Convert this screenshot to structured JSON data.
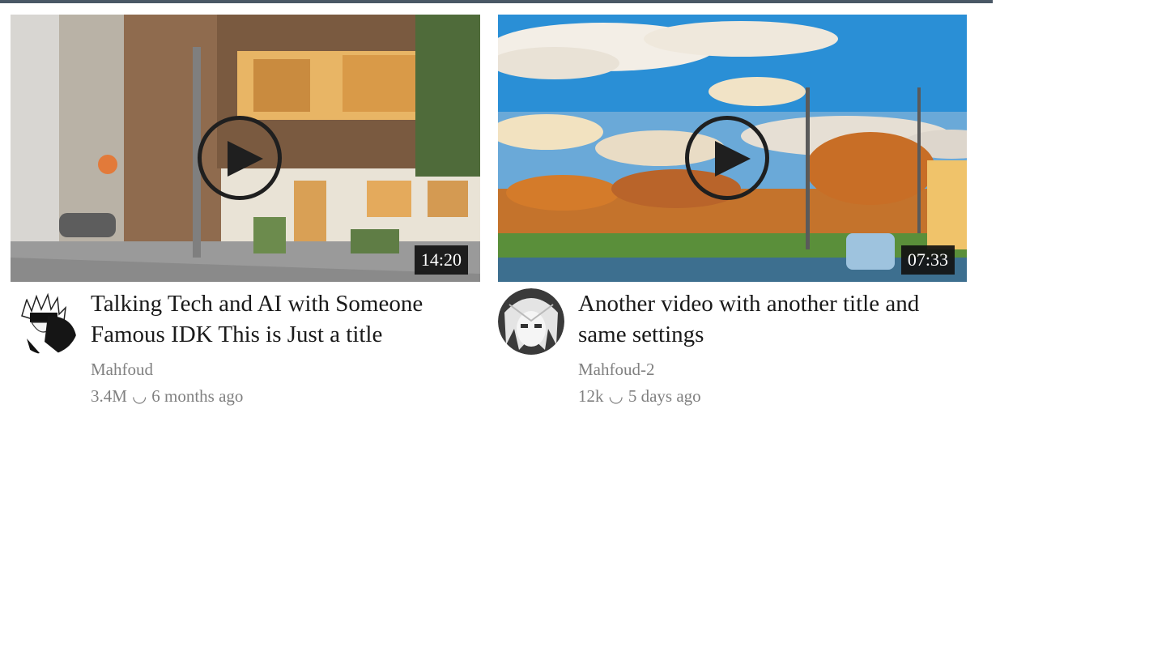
{
  "videos": [
    {
      "title": "Talking Tech and AI with Someone Famous IDK This is Just a title",
      "channel": "Mahfoud",
      "views": "3.4M",
      "separator": "◡",
      "age": "6 months ago",
      "duration": "14:20"
    },
    {
      "title": "Another video with another title and same settings",
      "channel": "Mahfoud-2",
      "views": "12k",
      "separator": "◡",
      "age": "5 days ago",
      "duration": "07:33"
    }
  ],
  "icons": {
    "play": "play-icon"
  }
}
